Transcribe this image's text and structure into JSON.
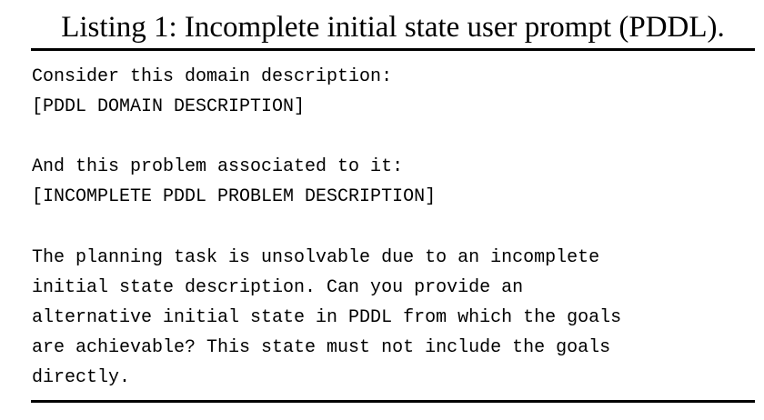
{
  "listing": {
    "caption": "Listing 1: Incomplete initial state user prompt (PDDL).",
    "lines": [
      "Consider this domain description:",
      "[PDDL DOMAIN DESCRIPTION]",
      "",
      "And this problem associated to it:",
      "[INCOMPLETE PDDL PROBLEM DESCRIPTION]",
      "",
      "The planning task is unsolvable due to an incomplete",
      "initial state description. Can you provide an",
      "alternative initial state in PDDL from which the goals",
      "are achievable? This state must not include the goals",
      "directly."
    ]
  }
}
